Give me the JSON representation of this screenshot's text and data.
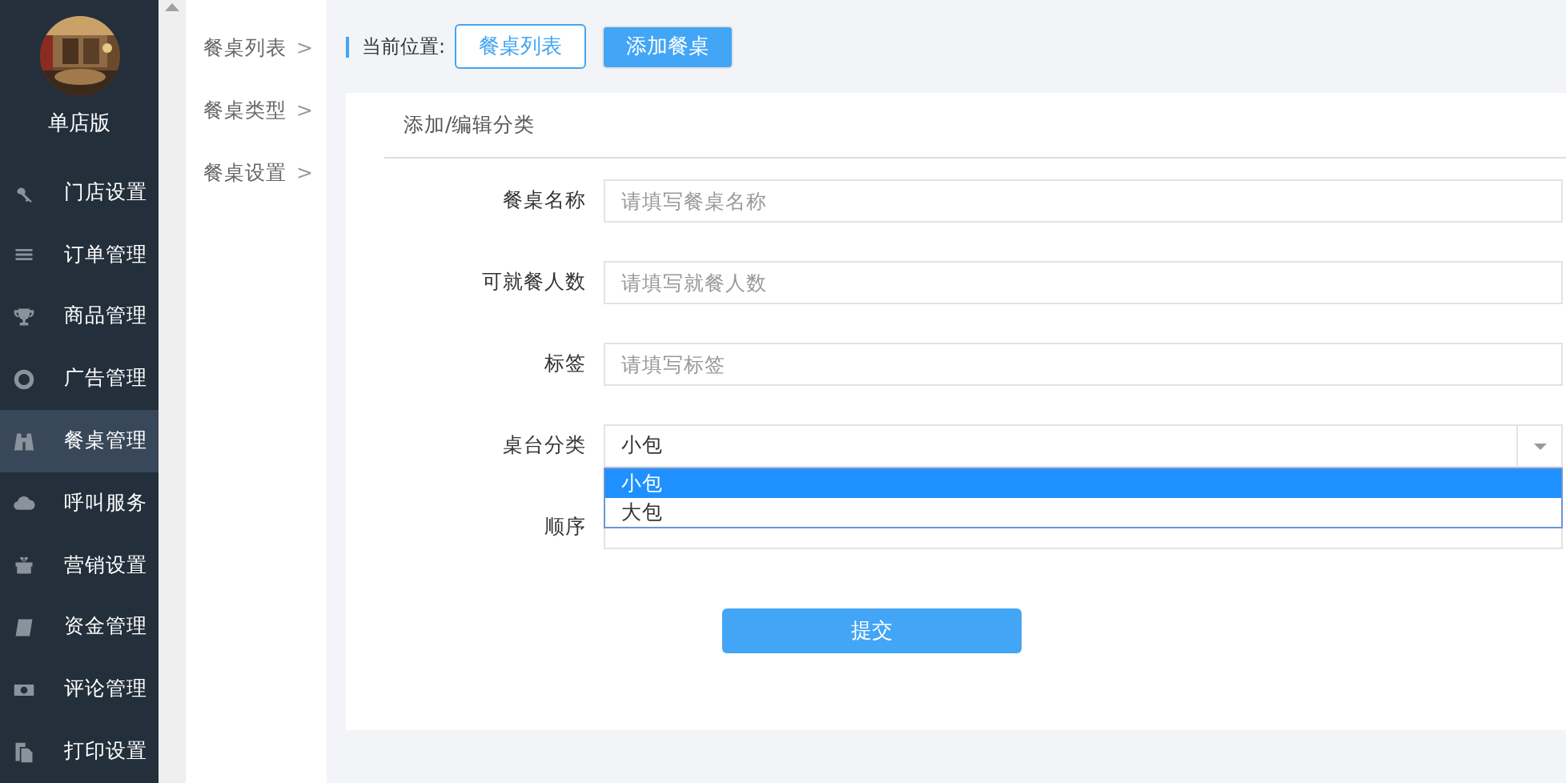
{
  "sidebar": {
    "edition": "单店版",
    "items": [
      {
        "label": "门店设置",
        "selected": false
      },
      {
        "label": "订单管理",
        "selected": false
      },
      {
        "label": "商品管理",
        "selected": false
      },
      {
        "label": "广告管理",
        "selected": false
      },
      {
        "label": "餐桌管理",
        "selected": true
      },
      {
        "label": "呼叫服务",
        "selected": false
      },
      {
        "label": "营销设置",
        "selected": false
      },
      {
        "label": "资金管理",
        "selected": false
      },
      {
        "label": "评论管理",
        "selected": false
      },
      {
        "label": "打印设置",
        "selected": false
      }
    ]
  },
  "submenu": [
    {
      "label": "餐桌列表",
      "arrow": ">"
    },
    {
      "label": "餐桌类型",
      "arrow": ">"
    },
    {
      "label": "餐桌设置",
      "arrow": ">"
    }
  ],
  "breadcrumb": {
    "label": "当前位置:",
    "buttons": [
      {
        "label": "餐桌列表",
        "selected": false
      },
      {
        "label": "添加餐桌",
        "selected": true
      }
    ]
  },
  "form": {
    "title": "添加/编辑分类",
    "fields": [
      {
        "kind": "input",
        "label": "餐桌名称",
        "placeholder": "请填写餐桌名称"
      },
      {
        "kind": "input",
        "label": "可就餐人数",
        "placeholder": "请填写就餐人数"
      },
      {
        "kind": "input",
        "label": "标签",
        "placeholder": "请填写标签"
      },
      {
        "kind": "select",
        "label": "桌台分类",
        "value": "小包",
        "expanded": true,
        "options": [
          {
            "label": "小包",
            "selected": true
          },
          {
            "label": "大包",
            "selected": false
          }
        ]
      },
      {
        "kind": "input",
        "label": "顺序"
      }
    ],
    "submit": "提交"
  }
}
